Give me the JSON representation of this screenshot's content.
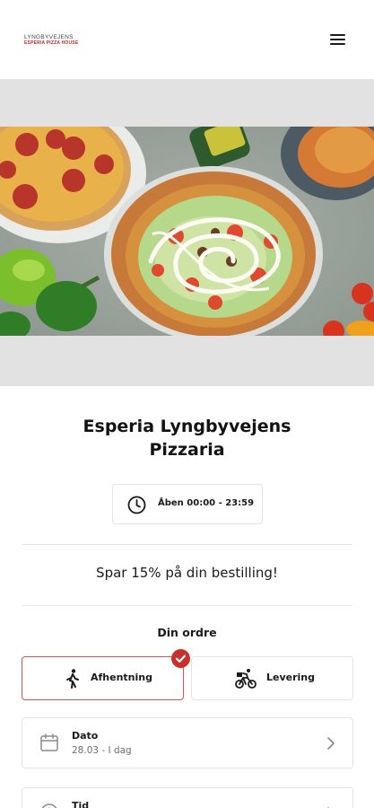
{
  "header": {
    "logo_line1": "LYNGBYVEJENS",
    "logo_line2": "ESPERIA PIZZA HOUSE",
    "menu_icon": "hamburger-menu-icon"
  },
  "hero": {
    "image_icon": "pizza-photo"
  },
  "store": {
    "name_line1": "Esperia Lyngbyvejens",
    "name_line2": "Pizzaria",
    "hours": "Åben 00:00 - 23:59"
  },
  "promo": {
    "text": "Spar 15% på din bestilling!"
  },
  "order": {
    "label": "Din ordre",
    "pickup_label": "Afhentning",
    "delivery_label": "Levering",
    "selected": "Afhentning",
    "accent_color": "#c9302c"
  },
  "date_row": {
    "title": "Dato",
    "value": "28.03 - I dag"
  },
  "time_row": {
    "title": "Tid"
  }
}
